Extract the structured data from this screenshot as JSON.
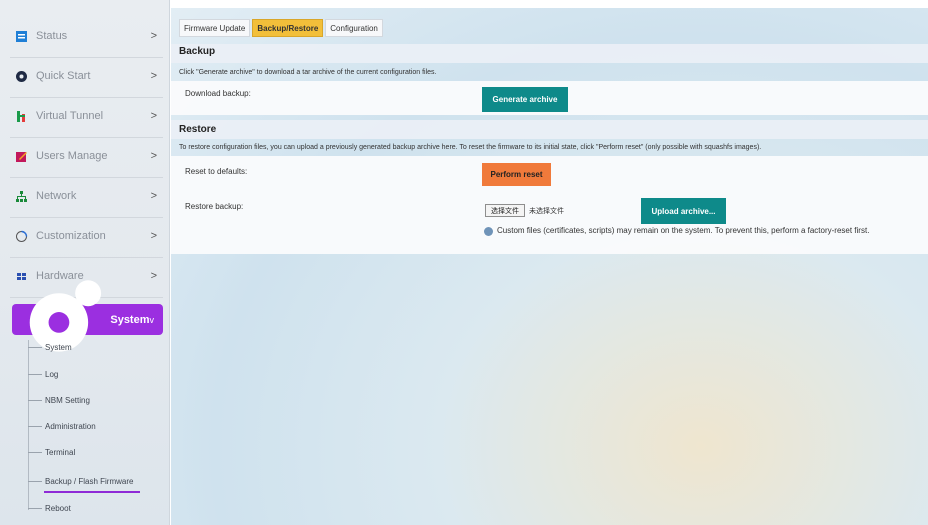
{
  "sidebar": {
    "items": [
      {
        "label": "Status",
        "icon": "status-icon",
        "chevron": ">"
      },
      {
        "label": "Quick Start",
        "icon": "gear-icon",
        "chevron": ">"
      },
      {
        "label": "Virtual Tunnel",
        "icon": "tunnel-icon",
        "chevron": ">"
      },
      {
        "label": "Users Manage",
        "icon": "users-icon",
        "chevron": ">"
      },
      {
        "label": "Network",
        "icon": "network-icon",
        "chevron": ">"
      },
      {
        "label": "Customization",
        "icon": "customization-icon",
        "chevron": ">"
      },
      {
        "label": "Hardware",
        "icon": "hardware-icon",
        "chevron": ">"
      }
    ],
    "active": {
      "label": "System",
      "icon": "system-gear-icon",
      "chevron": "v"
    },
    "sub_items": [
      "System",
      "Log",
      "NBM Setting",
      "Administration",
      "Terminal",
      "Backup / Flash Firmware",
      "Reboot"
    ],
    "active_sub": "Backup / Flash Firmware",
    "accent": "#9b2fe0"
  },
  "tabs": [
    {
      "label": "Firmware Update"
    },
    {
      "label": "Backup/Restore"
    },
    {
      "label": "Configuration"
    }
  ],
  "active_tab": "Backup/Restore",
  "backup": {
    "title": "Backup",
    "description": "Click \"Generate archive\" to download a tar archive of the current configuration files.",
    "download_label": "Download backup:",
    "generate_button": "Generate archive"
  },
  "restore": {
    "title": "Restore",
    "description": "To restore configuration files, you can upload a previously generated backup archive here. To reset the firmware to its initial state, click \"Perform reset\" (only possible with squashfs images).",
    "reset_label": "Reset to defaults:",
    "reset_button": "Perform reset",
    "restore_label": "Restore backup:",
    "choose_file": "选择文件",
    "no_file": "未选择文件",
    "upload_button": "Upload archive...",
    "note": "Custom files (certificates, scripts) may remain on the system. To prevent this, perform a factory-reset first."
  },
  "colors": {
    "teal_button": "#0e8a8a",
    "orange_button": "#f07a3b",
    "active_tab": "#f2bf3a"
  }
}
